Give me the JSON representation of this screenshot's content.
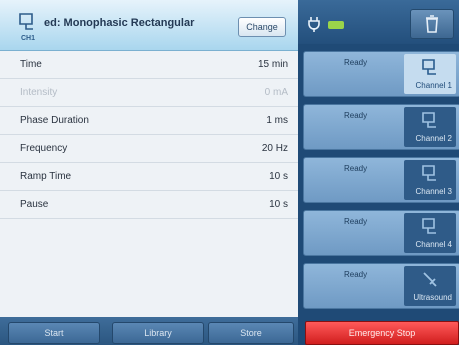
{
  "header": {
    "channel_icon_label": "CH1",
    "program_title": "ed: Monophasic Rectangular",
    "change_label": "Change"
  },
  "params": [
    {
      "label": "Time",
      "value": "15 min",
      "enabled": true
    },
    {
      "label": "Intensity",
      "value": "0 mA",
      "enabled": false
    },
    {
      "label": "Phase Duration",
      "value": "1 ms",
      "enabled": true
    },
    {
      "label": "Frequency",
      "value": "20 Hz",
      "enabled": true
    },
    {
      "label": "Ramp Time",
      "value": "10 s",
      "enabled": true
    },
    {
      "label": "Pause",
      "value": "10 s",
      "enabled": true
    }
  ],
  "bottom_bar": {
    "start_label": "Start",
    "library_label": "Library",
    "store_label": "Store"
  },
  "channels": [
    {
      "status": "Ready",
      "label": "Channel 1",
      "selected": true
    },
    {
      "status": "Ready",
      "label": "Channel 2",
      "selected": false
    },
    {
      "status": "Ready",
      "label": "Channel 3",
      "selected": false
    },
    {
      "status": "Ready",
      "label": "Channel 4",
      "selected": false
    },
    {
      "status": "Ready",
      "label": "Ultrasound",
      "selected": false
    }
  ],
  "emergency_stop_label": "Emergency Stop",
  "colors": {
    "accent": "#2e5a86",
    "emergency": "#e22a2a",
    "battery": "#9ad44a"
  },
  "icons": {
    "status_bar": [
      "plug-icon",
      "battery-icon"
    ],
    "trash": "trash-icon",
    "electrode": "electrode-icon",
    "ultrasound": "ultrasound-probe-icon"
  }
}
